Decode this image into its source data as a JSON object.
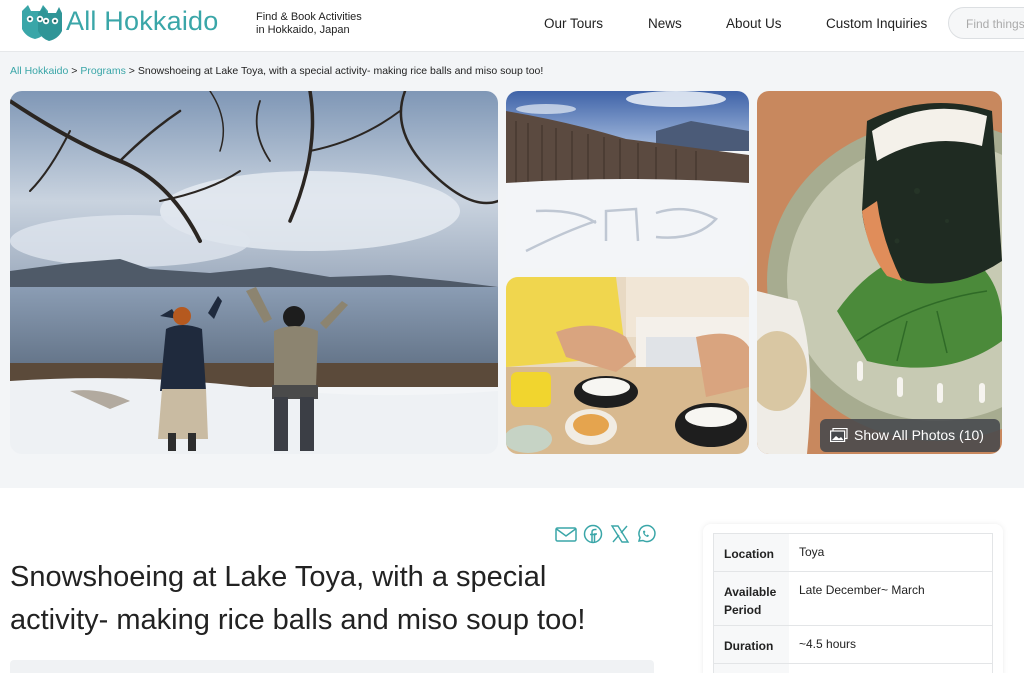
{
  "header": {
    "brand": "All Hokkaido",
    "tagline_line1": "Find & Book Activities",
    "tagline_line2": "in Hokkaido, Japan",
    "nav": [
      "Our Tours",
      "News",
      "About Us",
      "Custom Inquiries"
    ],
    "search_placeholder": "Find things"
  },
  "breadcrumb": {
    "home": "All Hokkaido",
    "sep": ">",
    "programs": "Programs",
    "current": "Snowshoeing at Lake Toya, with a special activity- making rice balls and miso soup too!"
  },
  "gallery": {
    "photos": [
      "lake-toya-people-photo",
      "snow-field-photo",
      "rice-ball-making-photo",
      "rice-ball-plate-photo"
    ],
    "show_all_label": "Show All Photos (10)"
  },
  "share": [
    "email-icon",
    "facebook-icon",
    "x-icon",
    "whatsapp-icon"
  ],
  "program": {
    "title": "Snowshoeing at Lake Toya, with a special activity- making rice balls and miso soup too!"
  },
  "info": [
    {
      "label": "Location",
      "value": "Toya"
    },
    {
      "label": "Available Period",
      "value": "Late December~ March"
    },
    {
      "label": "Duration",
      "value": "~4.5 hours"
    }
  ],
  "colors": {
    "accent": "#3aa6a8",
    "text": "#222222",
    "overlay": "#46484c"
  }
}
